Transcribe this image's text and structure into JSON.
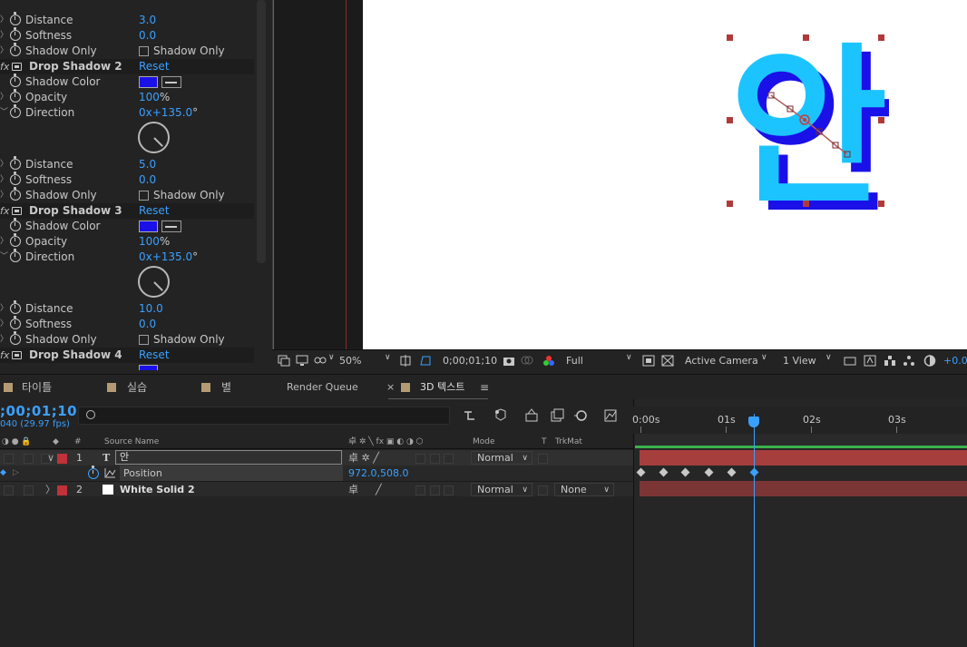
{
  "effect_controls": {
    "rows": [
      {
        "name": "Distance",
        "value": "3.0"
      },
      {
        "name": "Softness",
        "value": "0.0"
      },
      {
        "name": "Shadow Only",
        "checkbox_label": "Shadow Only"
      },
      {
        "name": "Drop Shadow 2",
        "reset": "Reset"
      },
      {
        "name": "Shadow Color"
      },
      {
        "name": "Opacity",
        "value": "100",
        "unit": "%"
      },
      {
        "name": "Direction",
        "value": "0x+135.0",
        "unit": "°"
      },
      {
        "name": "Distance",
        "value": "5.0"
      },
      {
        "name": "Softness",
        "value": "0.0"
      },
      {
        "name": "Shadow Only",
        "checkbox_label": "Shadow Only"
      },
      {
        "name": "Drop Shadow 3",
        "reset": "Reset"
      },
      {
        "name": "Shadow Color"
      },
      {
        "name": "Opacity",
        "value": "100",
        "unit": "%"
      },
      {
        "name": "Direction",
        "value": "0x+135.0",
        "unit": "°"
      },
      {
        "name": "Distance",
        "value": "10.0"
      },
      {
        "name": "Softness",
        "value": "0.0"
      },
      {
        "name": "Shadow Only",
        "checkbox_label": "Shadow Only"
      },
      {
        "name": "Drop Shadow 4",
        "reset": "Reset"
      }
    ],
    "fx_label": "fx",
    "shadow_color_hex": "#1a10e8"
  },
  "viewer": {
    "text_glyph": "안",
    "text_color": "#1cc4ff",
    "shadow_color": "#1a10e8",
    "toolbar": {
      "zoom": "50%",
      "timecode": "0;00;01;10",
      "resolution": "Full",
      "camera": "Active Camera",
      "view": "1 View",
      "exposure": "+0.0"
    }
  },
  "tabs": [
    {
      "label": "타이틀",
      "color": "#b59b74"
    },
    {
      "label": "실습",
      "color": "#b59b74"
    },
    {
      "label": "별",
      "color": "#b59b74"
    },
    {
      "label": "Render Queue"
    },
    {
      "label": "3D 텍스트",
      "active": true,
      "close": "×",
      "menu": "≡"
    }
  ],
  "timeline": {
    "timecode": ";00;01;10",
    "fps": "040 (29.97 fps)",
    "columns": {
      "source_name": "Source Name",
      "mode": "Mode",
      "t": "T",
      "trkmat": "TrkMat"
    },
    "layers": [
      {
        "number": "1",
        "type_icon": "T",
        "name": "안",
        "mode": "Normal",
        "label_color": "#c0313a"
      },
      {
        "number": "2",
        "name": "White Solid 2",
        "mode": "Normal",
        "trkmat": "None",
        "label_color": "#c0313a"
      }
    ],
    "position": {
      "name": "Position",
      "value": "972.0,508.0"
    },
    "ruler": [
      "0:00s",
      "01s",
      "02s",
      "03s"
    ],
    "playhead_seconds": 1.33,
    "keyframes_seconds": [
      0.0,
      0.27,
      0.53,
      0.8,
      1.07,
      1.33
    ]
  }
}
